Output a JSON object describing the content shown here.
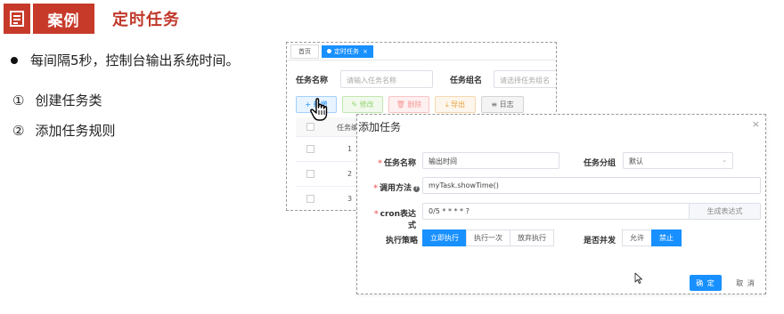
{
  "slide": {
    "badge_text": "案例",
    "title": "定时任务",
    "bullet": "每间隔5秒，控制台输出系统时间。",
    "steps": [
      {
        "num": "①",
        "text": "创建任务类"
      },
      {
        "num": "②",
        "text": "添加任务规则"
      }
    ]
  },
  "app": {
    "tab_home": "首页",
    "tab_active": "定时任务",
    "tab_close": "×",
    "search": {
      "name_label": "任务名称",
      "name_placeholder": "请输入任务名称",
      "group_label": "任务组名",
      "group_placeholder": "请选择任务组名"
    },
    "toolbar": {
      "add": "+ 新增",
      "edit": "✎ 修改",
      "delete": "🗑 删除",
      "export": "⤓ 导出",
      "log": "≡ 日志"
    },
    "table": {
      "header": "任务编",
      "rows": [
        "1",
        "2",
        "3"
      ]
    }
  },
  "dialog": {
    "title": "添加任务",
    "close": "×",
    "task_name_label": "任务名称",
    "task_name_value": "输出时间",
    "task_group_label": "任务分组",
    "task_group_value": "默认",
    "method_label": "调用方法",
    "method_value": "myTask.showTime()",
    "cron_label": "cron表达式",
    "cron_value": "0/5 * * * * ?",
    "cron_button": "生成表达式",
    "policy_label": "执行策略",
    "policy_options": [
      "立即执行",
      "执行一次",
      "放弃执行"
    ],
    "policy_selected": 0,
    "concurrent_label": "是否并发",
    "concurrent_options": [
      "允许",
      "禁止"
    ],
    "concurrent_selected": 1,
    "ok": "确 定",
    "cancel": "取 消"
  },
  "colors": {
    "brand_red": "#c73a2a",
    "primary": "#1890ff"
  }
}
